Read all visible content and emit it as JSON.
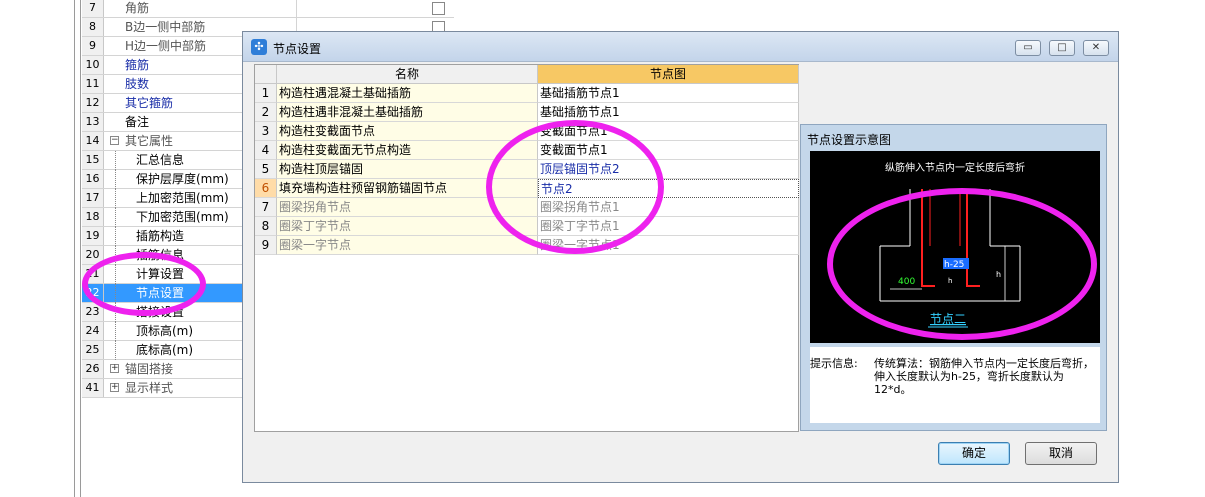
{
  "property_grid": {
    "rows": [
      {
        "num": "7",
        "name": "角筋",
        "style": "gray",
        "check": true
      },
      {
        "num": "8",
        "name": "B边一侧中部筋",
        "style": "gray",
        "check": true
      },
      {
        "num": "9",
        "name": "H边一侧中部筋",
        "style": "gray",
        "check": false
      },
      {
        "num": "10",
        "name": "箍筋",
        "style": "blue"
      },
      {
        "num": "11",
        "name": "肢数",
        "style": "blue"
      },
      {
        "num": "12",
        "name": "其它箍筋",
        "style": "blue"
      },
      {
        "num": "13",
        "name": "备注",
        "style": "normal"
      },
      {
        "num": "14",
        "name": "其它属性",
        "style": "gray",
        "toggle": "−"
      },
      {
        "num": "15",
        "name": "汇总信息",
        "style": "normal"
      },
      {
        "num": "16",
        "name": "保护层厚度(mm)",
        "style": "normal"
      },
      {
        "num": "17",
        "name": "上加密范围(mm)",
        "style": "normal"
      },
      {
        "num": "18",
        "name": "下加密范围(mm)",
        "style": "normal"
      },
      {
        "num": "19",
        "name": "插筋构造",
        "style": "normal"
      },
      {
        "num": "20",
        "name": "插筋信息",
        "style": "normal"
      },
      {
        "num": "21",
        "name": "计算设置",
        "style": "normal"
      },
      {
        "num": "22",
        "name": "节点设置",
        "style": "normal",
        "selected": true
      },
      {
        "num": "23",
        "name": "搭接设置",
        "style": "normal"
      },
      {
        "num": "24",
        "name": "顶标高(m)",
        "style": "normal"
      },
      {
        "num": "25",
        "name": "底标高(m)",
        "style": "normal"
      },
      {
        "num": "26",
        "name": "锚固搭接",
        "style": "gray",
        "toggle": "+"
      },
      {
        "num": "41",
        "name": "显示样式",
        "style": "gray",
        "toggle": "+"
      }
    ]
  },
  "dialog": {
    "title": "节点设置",
    "icon": "app-icon",
    "controls": {
      "minimize": "▭",
      "restore": "□",
      "close": "✕"
    },
    "table": {
      "headers": [
        "名称",
        "节点图"
      ],
      "rows": [
        {
          "num": "1",
          "name": "构造柱遇混凝土基础插筋",
          "node": "基础插筋节点1"
        },
        {
          "num": "2",
          "name": "构造柱遇非混凝土基础插筋",
          "node": "基础插筋节点1"
        },
        {
          "num": "3",
          "name": "构造柱变截面节点",
          "node": "变截面节点1"
        },
        {
          "num": "4",
          "name": "构造柱变截面无节点构造",
          "node": "变截面节点1"
        },
        {
          "num": "5",
          "name": "构造柱顶层锚固",
          "node": "顶层锚固节点2",
          "blue": true
        },
        {
          "num": "6",
          "name": "填充墙构造柱预留钢筋锚固节点",
          "node": "节点2",
          "blue": true,
          "current": true
        },
        {
          "num": "7",
          "name": "圈梁拐角节点",
          "node": "圈梁拐角节点1",
          "disabled": true
        },
        {
          "num": "8",
          "name": "圈梁丁字节点",
          "node": "圈梁丁字节点1",
          "disabled": true
        },
        {
          "num": "9",
          "name": "圈梁一字节点",
          "node": "圈梁一字节点1",
          "disabled": true
        }
      ]
    },
    "preview": {
      "title": "节点设置示意图",
      "diagram_caption": "纵筋伸入节点内一定长度后弯折",
      "dim_a": "400",
      "dim_b": "h-25",
      "dim_c": "h",
      "dim_d": "h",
      "node_label": "节点二",
      "hint_label": "提示信息:",
      "hint_text": "传统算法：钢筋伸入节点内一定长度后弯折，伸入长度默认为h-25，弯折长度默认为12*d。"
    },
    "ok_label": "确定",
    "cancel_label": "取消"
  },
  "colors": {
    "annotation": "#ee22ee",
    "selection": "#3399ff",
    "link_blue": "#1a2ea8"
  }
}
